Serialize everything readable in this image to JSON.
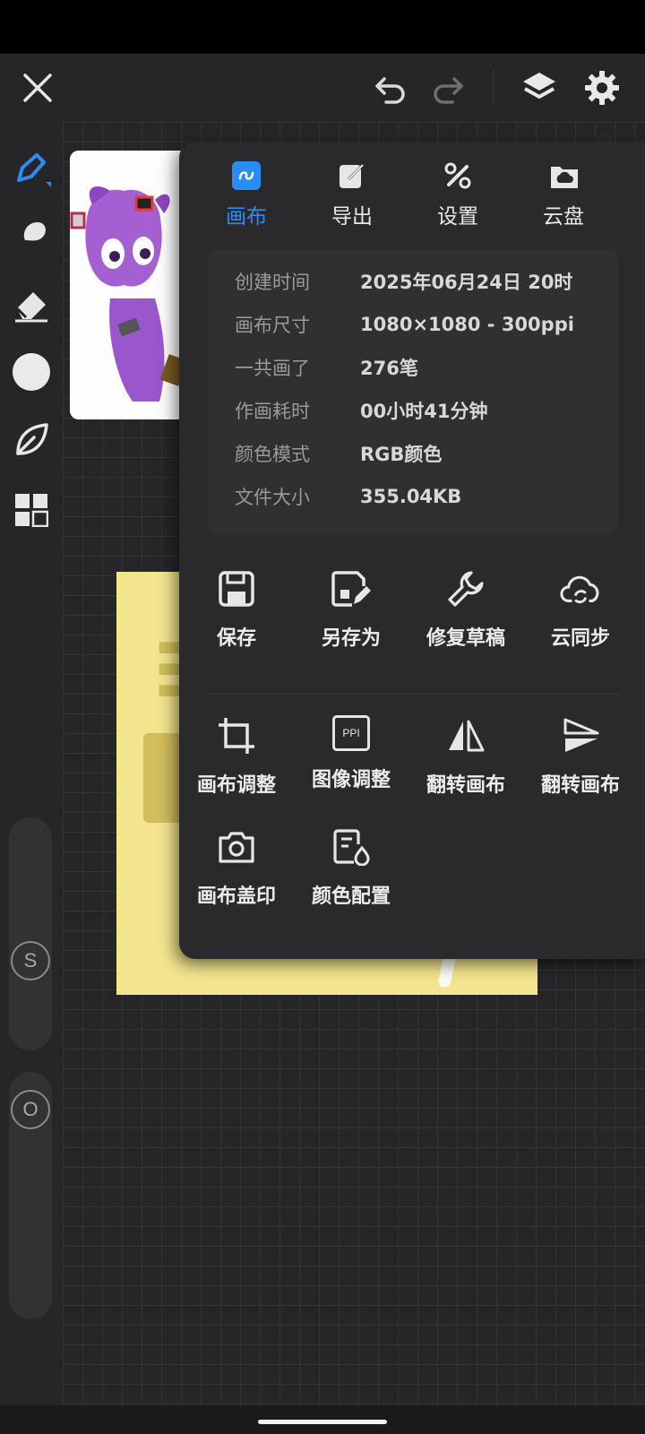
{
  "toolbar": {
    "close_icon": "close-icon",
    "undo_icon": "undo-icon",
    "redo_icon": "redo-icon",
    "layers_icon": "layers-icon",
    "settings_icon": "gear-icon"
  },
  "left_tools": [
    "brush-icon",
    "smudge-icon",
    "eraser-icon",
    "color-circle-icon",
    "leaf-icon",
    "grid-icon"
  ],
  "sliders": {
    "size_label": "S",
    "opacity_label": "O"
  },
  "panel": {
    "tabs": [
      {
        "label": "画布",
        "icon": "canvas-icon",
        "active": true
      },
      {
        "label": "导出",
        "icon": "export-icon",
        "active": false
      },
      {
        "label": "设置",
        "icon": "settings-tools-icon",
        "active": false
      },
      {
        "label": "云盘",
        "icon": "cloud-disk-icon",
        "active": false
      }
    ],
    "info": [
      {
        "key": "创建时间",
        "value": "2025年06月24日 20时"
      },
      {
        "key": "画布尺寸",
        "value": "1080×1080 - 300ppi"
      },
      {
        "key": "一共画了",
        "value": "276笔"
      },
      {
        "key": "作画耗时",
        "value": "00小时41分钟"
      },
      {
        "key": "颜色模式",
        "value": "RGB颜色"
      },
      {
        "key": "文件大小",
        "value": "355.04KB"
      }
    ],
    "actions_row1": [
      {
        "label": "保存",
        "icon": "save-icon"
      },
      {
        "label": "另存为",
        "icon": "save-as-icon"
      },
      {
        "label": "修复草稿",
        "icon": "wrench-icon"
      },
      {
        "label": "云同步",
        "icon": "cloud-sync-icon"
      }
    ],
    "actions_row2": [
      {
        "label": "画布调整",
        "icon": "crop-icon"
      },
      {
        "label": "图像调整",
        "icon": "ppi-icon",
        "badge": "PPI"
      },
      {
        "label": "翻转画布",
        "icon": "flip-horizontal-icon"
      },
      {
        "label": "翻转画布",
        "icon": "flip-vertical-icon"
      }
    ],
    "actions_row3": [
      {
        "label": "画布盖印",
        "icon": "camera-icon"
      },
      {
        "label": "颜色配置",
        "icon": "color-profile-icon"
      }
    ]
  },
  "colors": {
    "accent": "#2a8df5",
    "panel_bg": "#2a2a2c",
    "artwork_bg": "#f3e58e"
  }
}
